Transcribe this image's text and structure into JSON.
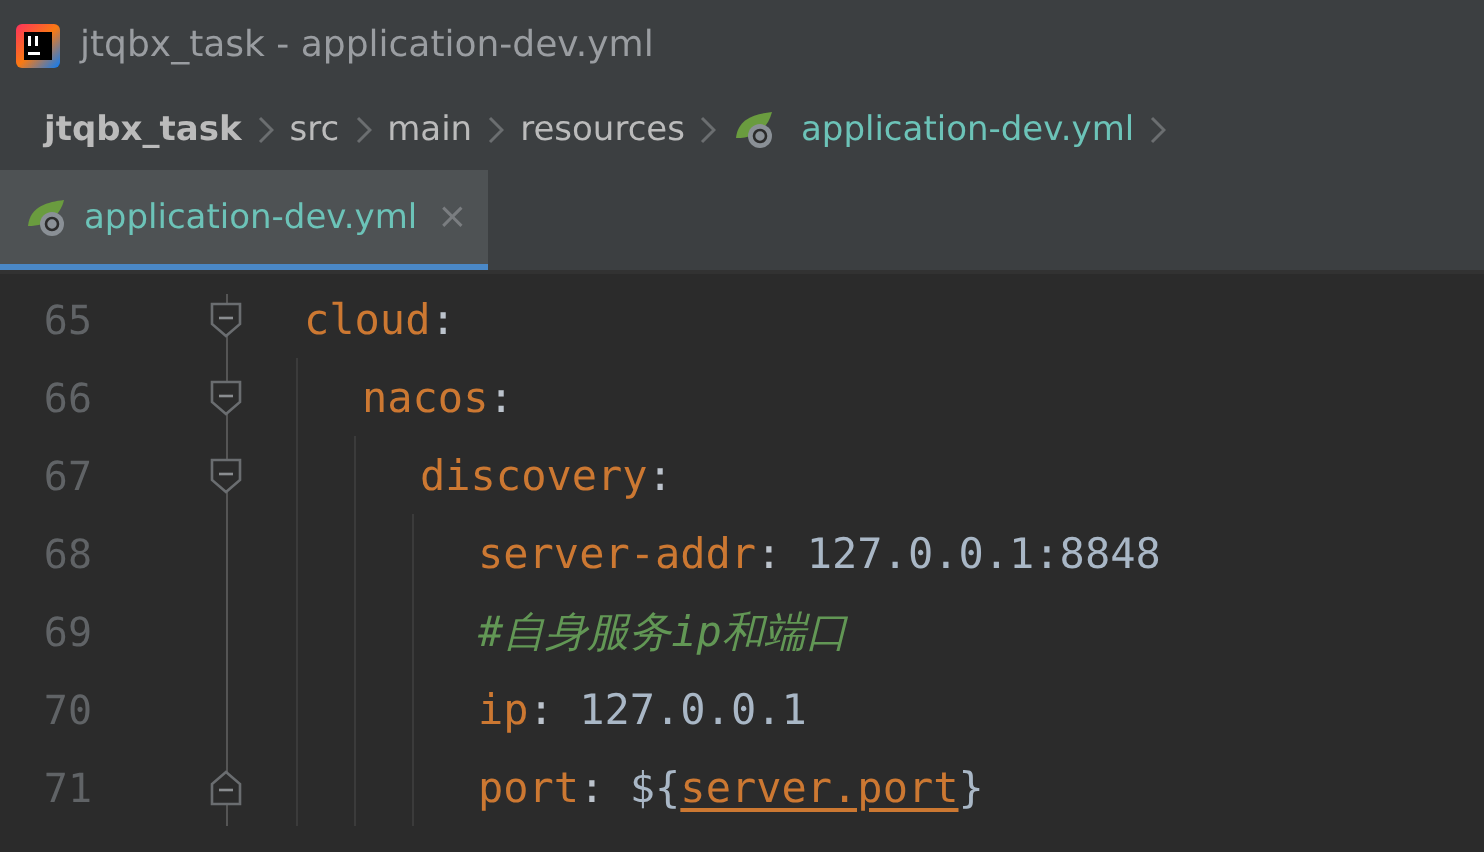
{
  "window": {
    "title": "jtqbx_task - application-dev.yml"
  },
  "breadcrumbs": [
    {
      "label": "jtqbx_task",
      "kind": "project"
    },
    {
      "label": "src",
      "kind": "folder"
    },
    {
      "label": "main",
      "kind": "folder"
    },
    {
      "label": "resources",
      "kind": "folder"
    },
    {
      "label": "application-dev.yml",
      "kind": "file"
    }
  ],
  "tabs": [
    {
      "label": "application-dev.yml",
      "selected": true,
      "close": "×"
    }
  ],
  "editor": {
    "lines": [
      {
        "number": "65",
        "fold_start": true,
        "fold_end": false,
        "tokens": [
          {
            "kind": "key",
            "text": "cloud"
          },
          {
            "kind": "punct",
            "text": ":"
          }
        ],
        "children": [
          {
            "number": "66",
            "fold_start": true,
            "fold_end": false,
            "tokens": [
              {
                "kind": "key",
                "text": "nacos"
              },
              {
                "kind": "punct",
                "text": ":"
              }
            ],
            "children": [
              {
                "number": "67",
                "fold_start": true,
                "fold_end": false,
                "tokens": [
                  {
                    "kind": "key",
                    "text": "discovery"
                  },
                  {
                    "kind": "punct",
                    "text": ":"
                  }
                ],
                "children": [
                  {
                    "number": "68",
                    "fold_start": false,
                    "fold_end": false,
                    "tokens": [
                      {
                        "kind": "key",
                        "text": "server-addr"
                      },
                      {
                        "kind": "punct",
                        "text": ": "
                      },
                      {
                        "kind": "value",
                        "text": "127.0.0.1:8848"
                      }
                    ]
                  },
                  {
                    "number": "69",
                    "fold_start": false,
                    "fold_end": false,
                    "tokens": [
                      {
                        "kind": "comment",
                        "text": "#自身服务ip和端口"
                      }
                    ]
                  },
                  {
                    "number": "70",
                    "fold_start": false,
                    "fold_end": false,
                    "tokens": [
                      {
                        "kind": "key",
                        "text": "ip"
                      },
                      {
                        "kind": "punct",
                        "text": ": "
                      },
                      {
                        "kind": "value",
                        "text": "127.0.0.1"
                      }
                    ]
                  },
                  {
                    "number": "71",
                    "fold_start": false,
                    "fold_end": true,
                    "tokens": [
                      {
                        "kind": "key",
                        "text": "port"
                      },
                      {
                        "kind": "punct",
                        "text": ": "
                      },
                      {
                        "kind": "value",
                        "text": "${"
                      },
                      {
                        "kind": "ref",
                        "text": "server.port"
                      },
                      {
                        "kind": "value",
                        "text": "}"
                      }
                    ]
                  }
                ]
              }
            ]
          }
        ]
      }
    ]
  }
}
